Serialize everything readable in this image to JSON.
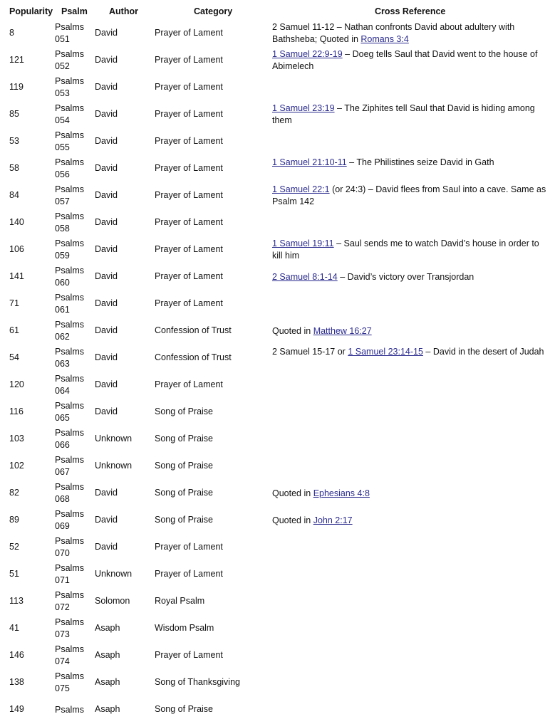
{
  "table": {
    "headers": {
      "popularity": "Popularity",
      "psalm": "Psalm",
      "author": "Author",
      "category": "Category",
      "cross_reference": "Cross Reference"
    },
    "link_color": "#2b2b8f",
    "rows": [
      {
        "popularity": "8",
        "psalm_book": "Psalms",
        "psalm_num": "051",
        "author": "David",
        "category": "Prayer of Lament",
        "xref": [
          {
            "t": "2 Samuel 11-12 – Nathan confronts David about adultery with Bathsheba; Quoted in "
          },
          {
            "t": "Romans 3:4",
            "link": true
          }
        ]
      },
      {
        "popularity": "121",
        "psalm_book": "Psalms",
        "psalm_num": "052",
        "author": "David",
        "category": "Prayer of Lament",
        "xref": [
          {
            "t": "1 Samuel 22:9-19",
            "link": true
          },
          {
            "t": " – Doeg tells Saul that David went to the house of Abimelech"
          }
        ]
      },
      {
        "popularity": "119",
        "psalm_book": "Psalms",
        "psalm_num": "053",
        "author": "David",
        "category": "Prayer of Lament",
        "xref": []
      },
      {
        "popularity": "85",
        "psalm_book": "Psalms",
        "psalm_num": "054",
        "author": "David",
        "category": "Prayer of Lament",
        "xref": [
          {
            "t": "1 Samuel 23:19",
            "link": true
          },
          {
            "t": " – The Ziphites tell Saul that David is hiding among them"
          }
        ]
      },
      {
        "popularity": "53",
        "psalm_book": "Psalms",
        "psalm_num": "055",
        "author": "David",
        "category": "Prayer of Lament",
        "xref": []
      },
      {
        "popularity": "58",
        "psalm_book": "Psalms",
        "psalm_num": "056",
        "author": "David",
        "category": "Prayer of Lament",
        "xref": [
          {
            "t": "1 Samuel 21:10-11",
            "link": true
          },
          {
            "t": " – The Philistines seize David in Gath"
          }
        ]
      },
      {
        "popularity": "84",
        "psalm_book": "Psalms",
        "psalm_num": "057",
        "author": "David",
        "category": "Prayer of Lament",
        "xref": [
          {
            "t": "1 Samuel 22:1",
            "link": true
          },
          {
            "t": " (or 24:3) – David flees from Saul into a cave. Same as Psalm 142"
          }
        ]
      },
      {
        "popularity": "140",
        "psalm_book": "Psalms",
        "psalm_num": "058",
        "author": "David",
        "category": "Prayer of Lament",
        "xref": []
      },
      {
        "popularity": "106",
        "psalm_book": "Psalms",
        "psalm_num": "059",
        "author": "David",
        "category": "Prayer of Lament",
        "xref": [
          {
            "t": "1 Samuel 19:11",
            "link": true
          },
          {
            "t": " – Saul sends me to watch David’s house in order to kill him"
          }
        ]
      },
      {
        "popularity": "141",
        "psalm_book": "Psalms",
        "psalm_num": "060",
        "author": "David",
        "category": "Prayer of Lament",
        "xref": [
          {
            "t": "2 Samuel 8:1-14",
            "link": true
          },
          {
            "t": " – David’s victory over Transjordan"
          }
        ]
      },
      {
        "popularity": "71",
        "psalm_book": "Psalms",
        "psalm_num": "061",
        "author": "David",
        "category": "Prayer of Lament",
        "xref": []
      },
      {
        "popularity": "61",
        "psalm_book": "Psalms",
        "psalm_num": "062",
        "author": "David",
        "category": "Confession of Trust",
        "xref": [
          {
            "t": "Quoted in "
          },
          {
            "t": "Matthew 16:27",
            "link": true
          }
        ]
      },
      {
        "popularity": "54",
        "psalm_book": "Psalms",
        "psalm_num": "063",
        "author": "David",
        "category": "Confession of Trust",
        "xref": [
          {
            "t": "2 Samuel 15-17 or "
          },
          {
            "t": "1 Samuel 23:14-15",
            "link": true
          },
          {
            "t": " – David in the desert of Judah"
          }
        ]
      },
      {
        "popularity": "120",
        "psalm_book": "Psalms",
        "psalm_num": "064",
        "author": "David",
        "category": "Prayer of Lament",
        "xref": []
      },
      {
        "popularity": "116",
        "psalm_book": "Psalms",
        "psalm_num": "065",
        "author": "David",
        "category": "Song of Praise",
        "xref": []
      },
      {
        "popularity": "103",
        "psalm_book": "Psalms",
        "psalm_num": "066",
        "author": "Unknown",
        "category": "Song of Praise",
        "xref": []
      },
      {
        "popularity": "102",
        "psalm_book": "Psalms",
        "psalm_num": "067",
        "author": "Unknown",
        "category": "Song of Praise",
        "xref": []
      },
      {
        "popularity": "82",
        "psalm_book": "Psalms",
        "psalm_num": "068",
        "author": "David",
        "category": "Song of Praise",
        "xref": [
          {
            "t": "Quoted in "
          },
          {
            "t": "Ephesians 4:8",
            "link": true
          }
        ]
      },
      {
        "popularity": "89",
        "psalm_book": "Psalms",
        "psalm_num": "069",
        "author": "David",
        "category": "Song of Praise",
        "xref": [
          {
            "t": "Quoted in "
          },
          {
            "t": "John 2:17",
            "link": true
          }
        ]
      },
      {
        "popularity": "52",
        "psalm_book": "Psalms",
        "psalm_num": "070",
        "author": "David",
        "category": "Prayer of Lament",
        "xref": []
      },
      {
        "popularity": "51",
        "psalm_book": "Psalms",
        "psalm_num": "071",
        "author": "Unknown",
        "category": "Prayer of Lament",
        "xref": []
      },
      {
        "popularity": "113",
        "psalm_book": "Psalms",
        "psalm_num": "072",
        "author": "Solomon",
        "category": "Royal Psalm",
        "xref": []
      },
      {
        "popularity": "41",
        "psalm_book": "Psalms",
        "psalm_num": "073",
        "author": "Asaph",
        "category": "Wisdom Psalm",
        "xref": []
      },
      {
        "popularity": "146",
        "psalm_book": "Psalms",
        "psalm_num": "074",
        "author": "Asaph",
        "category": "Prayer of Lament",
        "xref": []
      },
      {
        "popularity": "138",
        "psalm_book": "Psalms",
        "psalm_num": "075",
        "author": "Asaph",
        "category": "Song of Thanksgiving",
        "xref": []
      },
      {
        "popularity": "149",
        "psalm_book": "Psalms",
        "psalm_num": "",
        "author": "Asaph",
        "category": "Song of Praise",
        "xref": []
      }
    ]
  }
}
